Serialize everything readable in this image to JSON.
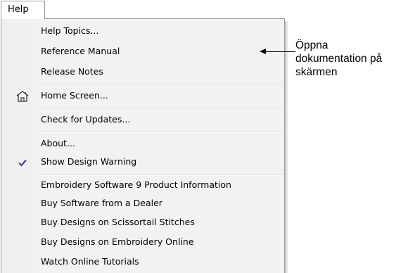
{
  "menubar": {
    "help_label": "Help"
  },
  "menu": {
    "items": [
      {
        "label": "Help Topics..."
      },
      {
        "label": "Reference Manual"
      },
      {
        "label": "Release Notes"
      },
      {
        "label": "Home Screen...",
        "icon": "home-screen-icon"
      },
      {
        "label": "Check for Updates..."
      },
      {
        "label": "About..."
      },
      {
        "label": "Show Design Warning",
        "checked": true,
        "icon": "checkmark-icon"
      },
      {
        "label": "Embroidery Software 9 Product Information"
      },
      {
        "label": "Buy Software from a Dealer"
      },
      {
        "label": "Buy Designs on Scissortail Stitches"
      },
      {
        "label": "Buy Designs on Embroidery Online"
      },
      {
        "label": "Watch Online Tutorials"
      }
    ]
  },
  "callout": {
    "lines": [
      "Öppna",
      "dokumentation på",
      "skärmen"
    ]
  },
  "colors": {
    "menu_background": "#f2f2f2",
    "border": "#9a9a9a",
    "checkmark": "#33528a"
  }
}
